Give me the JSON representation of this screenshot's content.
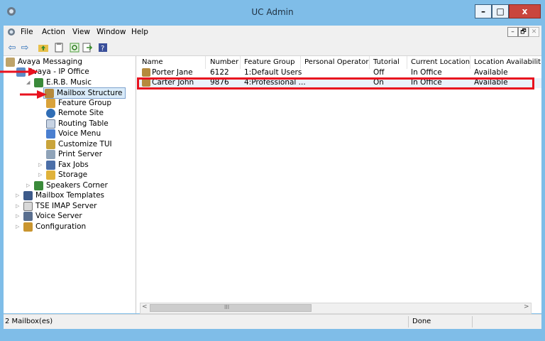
{
  "window": {
    "title": "UC Admin"
  },
  "menu": [
    "File",
    "Action",
    "View",
    "Window",
    "Help"
  ],
  "mdi_controls": [
    "–",
    "🗗",
    "✕"
  ],
  "tree": [
    {
      "label": "Avaya Messaging"
    },
    {
      "label": "Avaya - IP Office"
    },
    {
      "label": "E.R.B. Music"
    },
    {
      "label": "Mailbox Structure"
    },
    {
      "label": "Feature Group"
    },
    {
      "label": "Remote Site"
    },
    {
      "label": "Routing Table"
    },
    {
      "label": "Voice Menu"
    },
    {
      "label": "Customize TUI"
    },
    {
      "label": "Print Server"
    },
    {
      "label": "Fax Jobs"
    },
    {
      "label": "Storage"
    },
    {
      "label": "Speakers Corner"
    },
    {
      "label": "Mailbox Templates"
    },
    {
      "label": "TSE IMAP Server"
    },
    {
      "label": "Voice Server"
    },
    {
      "label": "Configuration"
    }
  ],
  "columns": [
    "Name",
    "Number",
    "Feature Group",
    "Personal Operator",
    "Tutorial",
    "Current Location",
    "Location Availabilit"
  ],
  "rows": [
    [
      "Porter Jane",
      "6122",
      "1:Default Users",
      "",
      "Off",
      "In Office",
      "Available"
    ],
    [
      "Carter John",
      "9876",
      "4:Professional ...",
      "",
      "On",
      "In Office",
      "Available"
    ]
  ],
  "hscroll": {
    "thumb_glyph": "III"
  },
  "status": {
    "left": "2 Mailbox(es)",
    "right": "Done"
  },
  "colors": {
    "titlebar": "#7fbde8",
    "selection": "#d9ebf9",
    "highlight": "#e8121f"
  }
}
